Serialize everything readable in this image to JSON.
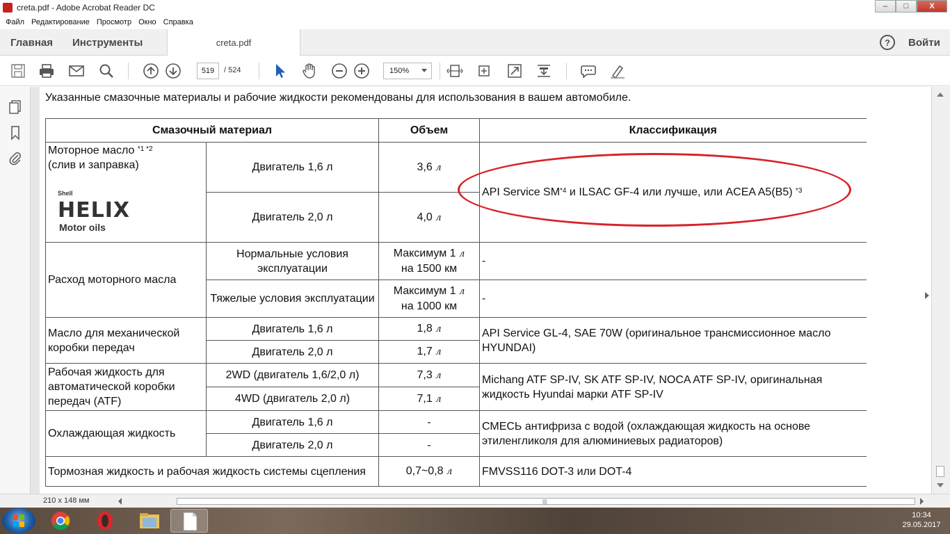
{
  "window": {
    "title": "creta.pdf - Adobe Acrobat Reader DC",
    "minimize": "–",
    "maximize": "□",
    "close": "X"
  },
  "menu": [
    "Файл",
    "Редактирование",
    "Просмотр",
    "Окно",
    "Справка"
  ],
  "tabs": {
    "home": "Главная",
    "tools": "Инструменты",
    "document": "creta.pdf",
    "help": "?",
    "login": "Войти"
  },
  "toolbar": {
    "page_current": "519",
    "page_total": "/ 524",
    "zoom": "150%"
  },
  "document": {
    "intro": "Указанные смазочные материалы и рабочие жидкости рекомендованы для использования в вашем автомобиле.",
    "headers": [
      "Смазочный материал",
      "Объем",
      "Классификация"
    ],
    "engine_oil": {
      "label": "Моторное масло",
      "sup": "*1 *2",
      "sub": "(слив и заправка)",
      "logo_brand": "Shell",
      "logo_name": "HELIX",
      "logo_sub": "Motor oils",
      "rows": [
        {
          "spec": "Двигатель 1,6 л",
          "vol": "3,6",
          "unit": "л"
        },
        {
          "spec": "Двигатель 2,0 л",
          "vol": "4,0",
          "unit": "л"
        }
      ],
      "class_main": "API Service SM",
      "class_sup1": "*4",
      "class_mid": " и ILSAC GF-4 или лучше, или ACEA A5(B5) ",
      "class_sup2": "*3"
    },
    "consumption": {
      "label": "Расход моторного масла",
      "rows": [
        {
          "spec": "Нормальные условия эксплуатации",
          "vol_a": "Максимум 1",
          "unit": "л",
          "vol_b": "на 1500 км",
          "class": "-"
        },
        {
          "spec": "Тяжелые условия эксплуатации",
          "vol_a": "Максимум 1",
          "unit": "л",
          "vol_b": "на 1000 км",
          "class": "-"
        }
      ]
    },
    "manual": {
      "label": "Масло для механической коробки передач",
      "rows": [
        {
          "spec": "Двигатель 1,6 л",
          "vol": "1,8",
          "unit": "л"
        },
        {
          "spec": "Двигатель 2,0 л",
          "vol": "1,7",
          "unit": "л"
        }
      ],
      "class": "API Service GL-4, SAE 70W (оригинальное трансмиссионное масло HYUNDAI)"
    },
    "atf": {
      "label": "Рабочая жидкость для автоматической коробки передач (ATF)",
      "rows": [
        {
          "spec": "2WD (двигатель 1,6/2,0 л)",
          "vol": "7,3",
          "unit": "л"
        },
        {
          "spec": "4WD (двигатель 2,0 л)",
          "vol": "7,1",
          "unit": "л"
        }
      ],
      "class": "Michang ATF SP-IV, SK ATF SP-IV, NOCA ATF SP-IV, оригинальная жидкость Hyundai марки ATF SP-IV"
    },
    "coolant": {
      "label": "Охлаждающая жидкость",
      "rows": [
        {
          "spec": "Двигатель 1,6 л",
          "vol": "-"
        },
        {
          "spec": "Двигатель 2,0 л",
          "vol": "-"
        }
      ],
      "class": "СМЕСЬ антифриза с водой (охлаждающая жидкость на основе этиленгликоля для алюминиевых радиаторов)"
    },
    "brake": {
      "label": "Тормозная жидкость и рабочая жидкость системы сцепления",
      "vol": "0,7~0,8",
      "unit": "л",
      "class": "FMVSS116 DOT-3 или DOT-4"
    }
  },
  "status": {
    "page_size": "210 x 148 мм",
    "grip": "|||"
  },
  "taskbar": {
    "time": "10:34",
    "date": "29.05.2017"
  },
  "colors": {
    "annotation": "#d8232a",
    "acrobat_red": "#c8201e",
    "select_tool": "#1d5fb4"
  }
}
